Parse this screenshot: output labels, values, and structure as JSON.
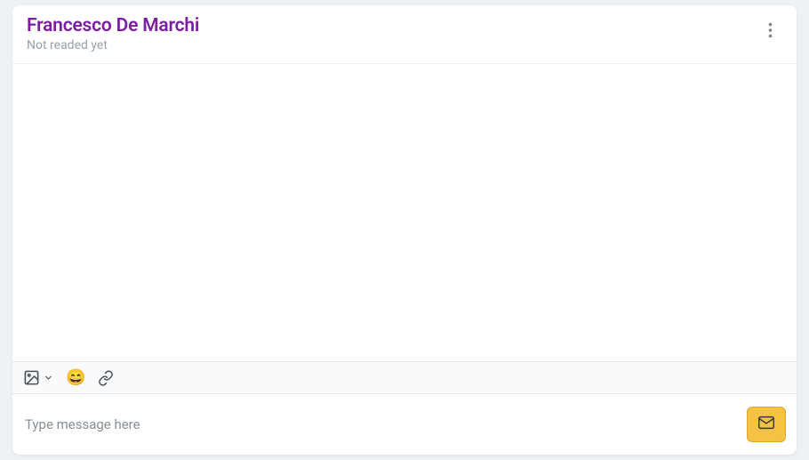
{
  "header": {
    "title": "Francesco De Marchi",
    "subtitle": "Not readed yet"
  },
  "toolbar": {
    "emoji_glyph": "😄"
  },
  "compose": {
    "placeholder": "Type message here",
    "value": ""
  },
  "colors": {
    "title": "#7b1fa2",
    "send_bg": "#f6c244",
    "send_border": "#d9a831",
    "page_bg": "#eef1f5"
  }
}
